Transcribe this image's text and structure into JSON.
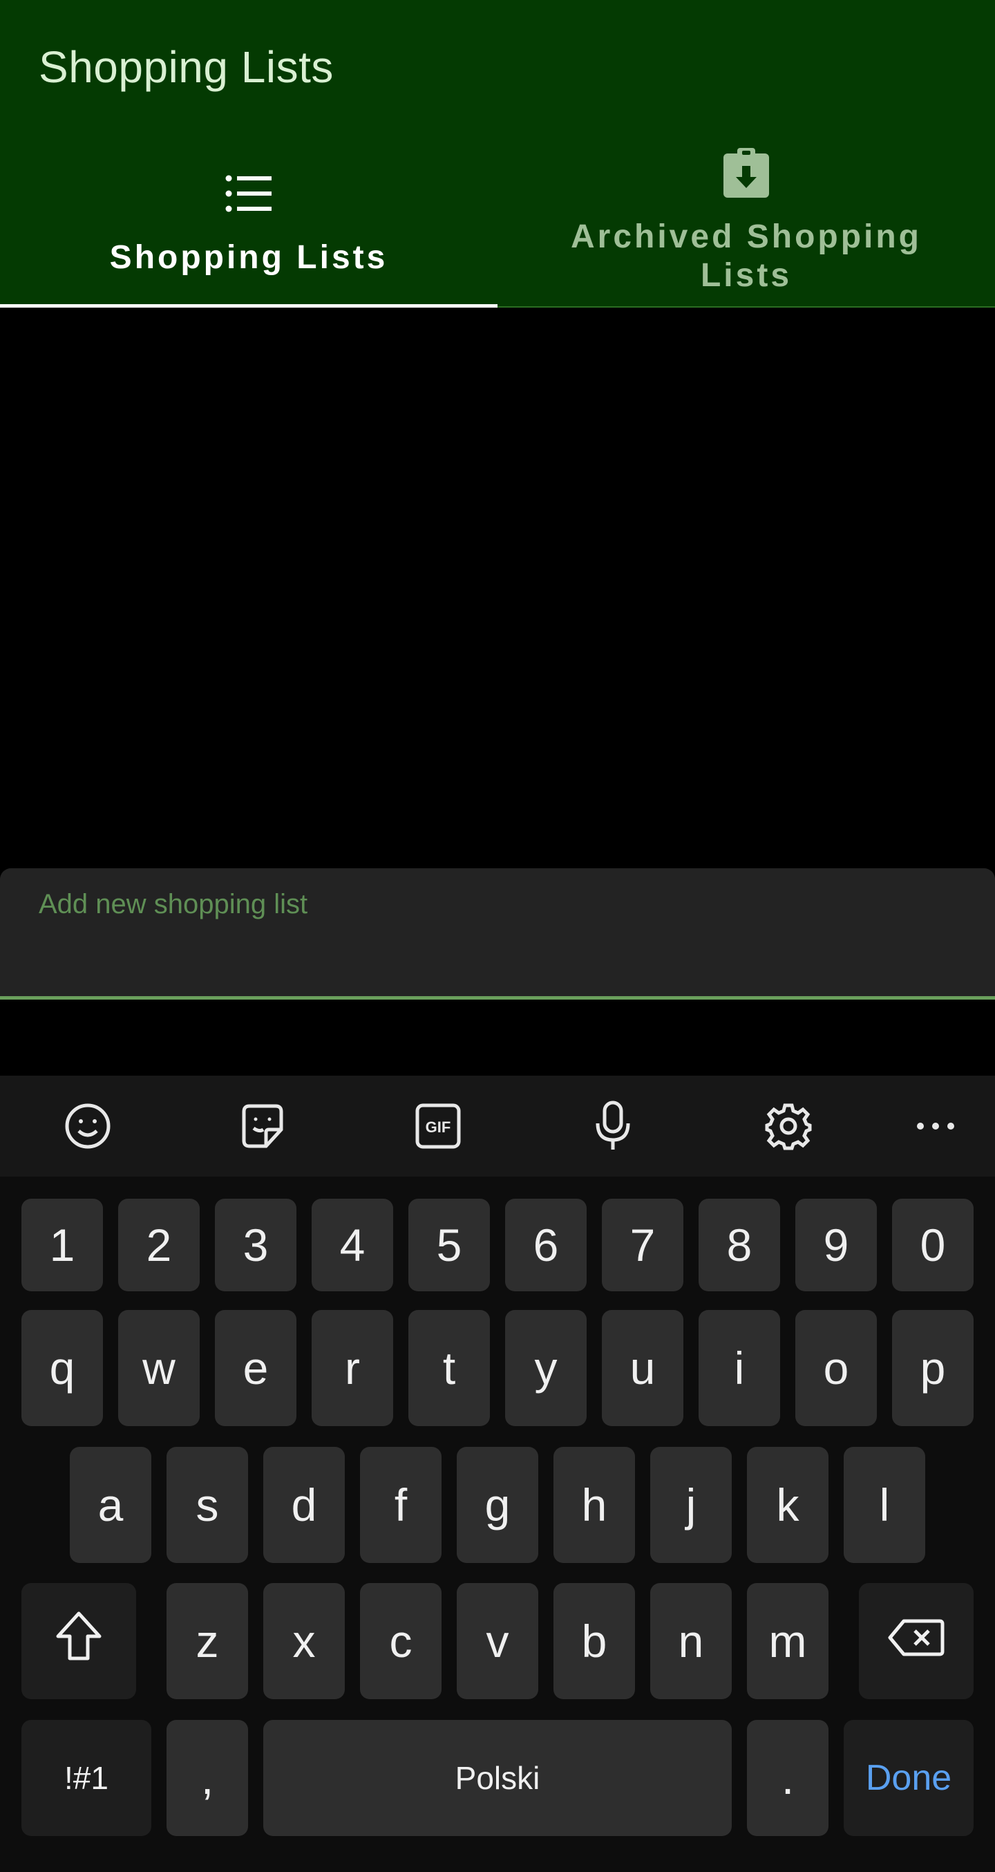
{
  "appbar": {
    "title": "Shopping Lists"
  },
  "tabs": [
    {
      "label": "Shopping Lists",
      "icon": "list-icon",
      "selected": true
    },
    {
      "label": "Archived Shopping Lists",
      "icon": "clipboard-download-icon",
      "selected": false
    }
  ],
  "input": {
    "placeholder": "Add new shopping list"
  },
  "keyboard": {
    "toolbar": [
      "emoji-icon",
      "sticker-icon",
      "gif-icon",
      "microphone-icon",
      "settings-gear-icon",
      "more-dots-icon"
    ],
    "numbers": [
      "1",
      "2",
      "3",
      "4",
      "5",
      "6",
      "7",
      "8",
      "9",
      "0"
    ],
    "row1": [
      "q",
      "w",
      "e",
      "r",
      "t",
      "y",
      "u",
      "i",
      "o",
      "p"
    ],
    "row2": [
      "a",
      "s",
      "d",
      "f",
      "g",
      "h",
      "j",
      "k",
      "l"
    ],
    "row3": [
      "z",
      "x",
      "c",
      "v",
      "b",
      "n",
      "m"
    ],
    "symbols_label": "!#1",
    "comma": ",",
    "space_label": "Polski",
    "period": ".",
    "done_label": "Done"
  },
  "colors": {
    "appbar": "#043a02",
    "indicator": "#ffffff",
    "placeholder": "#5f8f55",
    "done": "#5aa0f0"
  }
}
